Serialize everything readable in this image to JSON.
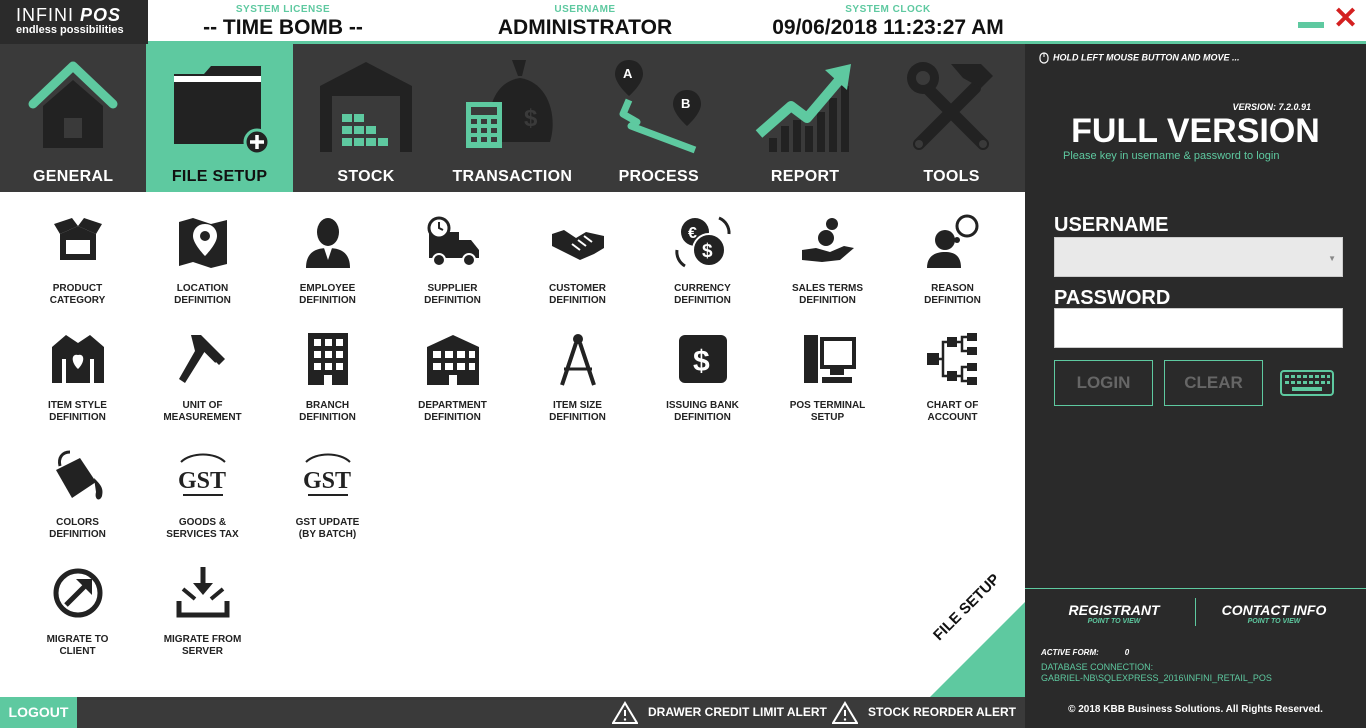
{
  "header": {
    "logo_line1a": "INFINI",
    "logo_line1b": "POS",
    "logo_line2": "endless possibilities",
    "license_caption": "SYSTEM LICENSE",
    "license_value": "-- TIME BOMB --",
    "username_caption": "USERNAME",
    "username_value": "ADMINISTRATOR",
    "clock_caption": "SYSTEM CLOCK",
    "clock_value": "09/06/2018 11:23:27 AM",
    "close_glyph": "✕"
  },
  "nav": [
    {
      "label": "GENERAL",
      "icon": "house-icon"
    },
    {
      "label": "FILE SETUP",
      "icon": "folder-add-icon"
    },
    {
      "label": "STOCK",
      "icon": "warehouse-icon"
    },
    {
      "label": "TRANSACTION",
      "icon": "money-bag-calculator-icon"
    },
    {
      "label": "PROCESS",
      "icon": "route-map-icon"
    },
    {
      "label": "REPORT",
      "icon": "growth-chart-icon"
    },
    {
      "label": "TOOLS",
      "icon": "hammer-wrench-icon"
    }
  ],
  "grid": [
    {
      "line1": "PRODUCT",
      "line2": "CATEGORY",
      "icon": "box-icon"
    },
    {
      "line1": "LOCATION",
      "line2": "DEFINITION",
      "icon": "map-pin-icon"
    },
    {
      "line1": "EMPLOYEE",
      "line2": "DEFINITION",
      "icon": "person-icon"
    },
    {
      "line1": "SUPPLIER",
      "line2": "DEFINITION",
      "icon": "truck-icon"
    },
    {
      "line1": "CUSTOMER",
      "line2": "DEFINITION",
      "icon": "handshake-icon"
    },
    {
      "line1": "CURRENCY",
      "line2": "DEFINITION",
      "icon": "currency-exchange-icon"
    },
    {
      "line1": "SALES TERMS",
      "line2": "DEFINITION",
      "icon": "hand-coin-icon"
    },
    {
      "line1": "REASON",
      "line2": "DEFINITION",
      "icon": "thinking-person-icon"
    },
    {
      "line1": "ITEM STYLE",
      "line2": "DEFINITION",
      "icon": "jacket-icon"
    },
    {
      "line1": "UNIT OF",
      "line2": "MEASUREMENT",
      "icon": "caliper-icon"
    },
    {
      "line1": "BRANCH",
      "line2": "DEFINITION",
      "icon": "building-icon"
    },
    {
      "line1": "DEPARTMENT",
      "line2": "DEFINITION",
      "icon": "office-building-icon"
    },
    {
      "line1": "ITEM SIZE",
      "line2": "DEFINITION",
      "icon": "compass-icon"
    },
    {
      "line1": "ISSUING BANK",
      "line2": "DEFINITION",
      "icon": "dollar-card-icon"
    },
    {
      "line1": "POS TERMINAL",
      "line2": "SETUP",
      "icon": "pos-terminal-icon"
    },
    {
      "line1": "CHART OF",
      "line2": "ACCOUNT",
      "icon": "hierarchy-icon"
    },
    {
      "line1": "COLORS",
      "line2": "DEFINITION",
      "icon": "paint-bucket-icon"
    },
    {
      "line1": "GOODS &",
      "line2": "SERVICES TAX",
      "icon": "gst-icon"
    },
    {
      "line1": "GST UPDATE",
      "line2": "(BY BATCH)",
      "icon": "gst-icon"
    },
    {
      "line1": "MIGRATE TO",
      "line2": "CLIENT",
      "icon": "migrate-out-icon"
    },
    {
      "line1": "MIGRATE FROM",
      "line2": "SERVER",
      "icon": "migrate-in-icon"
    }
  ],
  "gst_text": "GST",
  "corner_label": "FILE SETUP",
  "footer": {
    "logout": "LOGOUT",
    "alert1": "DRAWER CREDIT LIMIT ALERT",
    "alert2": "STOCK REORDER ALERT"
  },
  "side": {
    "drag_hint": "HOLD LEFT MOUSE BUTTON AND MOVE ...",
    "version": "VERSION: 7.2.0.91",
    "full_version": "FULL VERSION",
    "hint": "Please key in username & password to login",
    "username_label": "USERNAME",
    "password_label": "PASSWORD",
    "dropdown_glyph": "▼",
    "login": "LOGIN",
    "clear": "CLEAR",
    "registrant": "REGISTRANT",
    "contact": "CONTACT INFO",
    "point_to_view": "POINT TO VIEW",
    "active_form_label": "ACTIVE FORM:",
    "active_form_value": "0",
    "db_label": "DATABASE CONNECTION:",
    "db_value": "GABRIEL-NB\\SQLEXPRESS_2016\\INFINI_RETAIL_POS",
    "copyright": "© 2018 KBB Business Solutions. All Rights Reserved."
  },
  "colors": {
    "accent": "#5ec9a0",
    "dark": "#3a3a3a",
    "panel": "#2a2a2a",
    "close": "#d42020"
  }
}
